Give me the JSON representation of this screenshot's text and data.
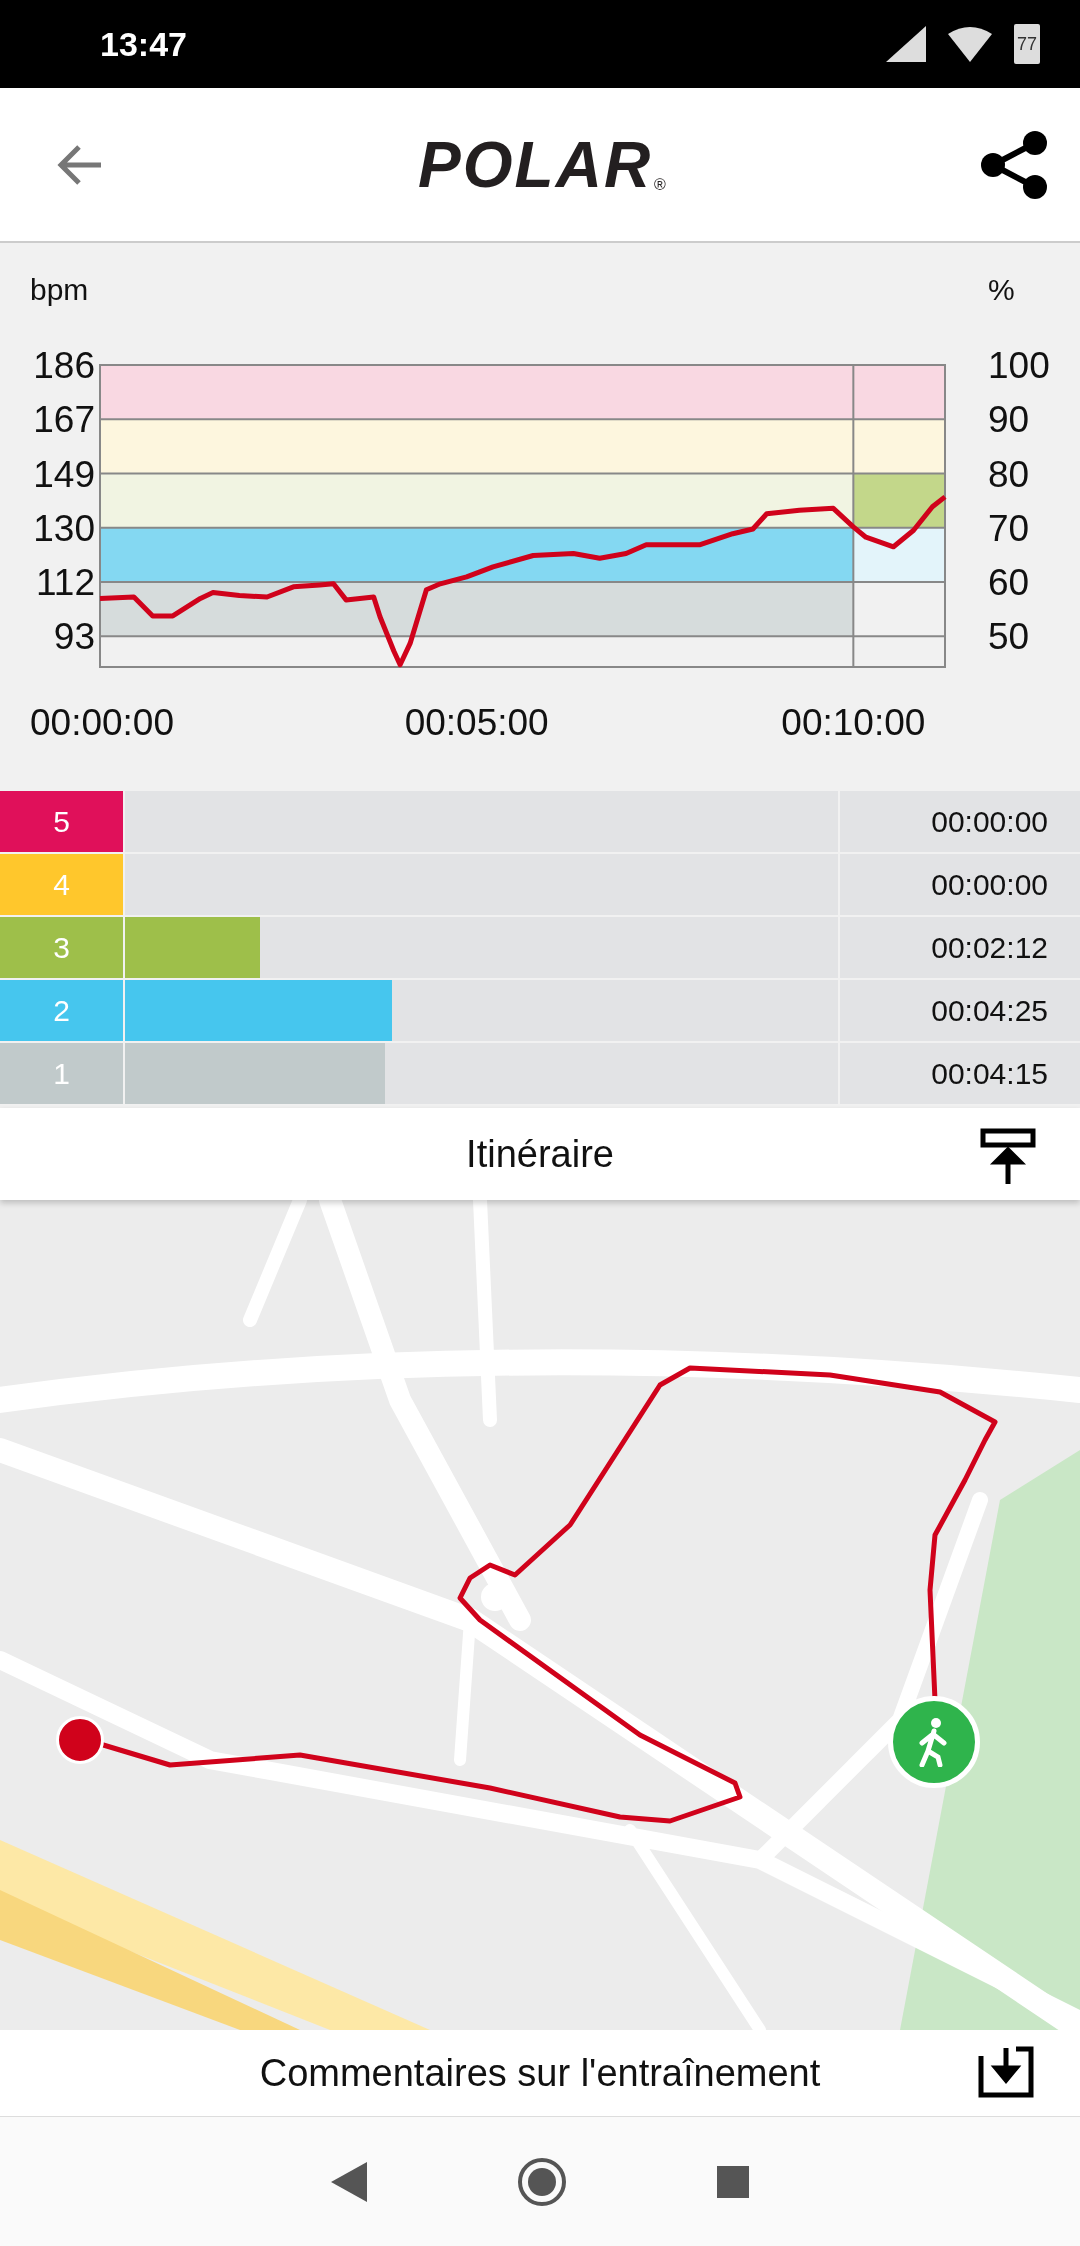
{
  "status_bar": {
    "time": "13:47",
    "battery": "77"
  },
  "header": {
    "logo": "POLAR",
    "logo_mark": "®"
  },
  "heart_rate": {
    "left_unit": "bpm",
    "right_unit": "%",
    "right_ticks": [
      "100",
      "90",
      "80",
      "70",
      "60",
      "50"
    ],
    "zone_colors": [
      {
        "color": "#f9d8e2"
      },
      {
        "color": "#fdf6de"
      },
      {
        "color": "#f1f4e2"
      },
      {
        "color": "#84d8f2"
      },
      {
        "color": "#d6dcdc"
      }
    ],
    "current_column": [
      {
        "color": "#f9d8e2"
      },
      {
        "color": "#fdf6de"
      },
      {
        "color": "#c3d78a"
      },
      {
        "color": "#e3f4fa"
      }
    ],
    "chart_data": {
      "type": "line",
      "grid": true,
      "x": [
        0,
        27,
        42,
        58,
        80,
        90,
        111,
        133,
        154,
        175,
        186,
        196,
        218,
        223,
        234,
        239,
        247,
        260,
        271,
        292,
        313,
        345,
        377,
        398,
        419,
        435,
        478,
        504,
        520,
        531,
        557,
        584,
        600,
        610,
        632,
        648,
        663,
        673
      ],
      "series": [
        {
          "color": "#d0021b",
          "values": [
            106,
            106.5,
            100,
            100,
            106,
            108,
            107,
            106.5,
            110,
            110.6,
            111,
            105.5,
            106.5,
            99.7,
            88,
            83.3,
            90.6,
            109,
            111,
            113.4,
            116.8,
            120.7,
            121.4,
            119.8,
            121.4,
            124.4,
            124.4,
            128.2,
            129.8,
            135,
            136.2,
            136.9,
            130.5,
            127,
            123.7,
            129.4,
            137.4,
            140.8
          ]
        }
      ],
      "xlim": [
        0,
        673
      ],
      "ylim": [
        82.5,
        186
      ],
      "xticks": [
        {
          "value": 0,
          "label": "00:00:00"
        },
        {
          "value": 300,
          "label": "00:05:00"
        },
        {
          "value": 600,
          "label": "00:10:00"
        }
      ],
      "yticks": [
        {
          "value": 93,
          "label": "93"
        },
        {
          "value": 111.6,
          "label": "112"
        },
        {
          "value": 130.2,
          "label": "130"
        },
        {
          "value": 148.8,
          "label": "149"
        },
        {
          "value": 167.4,
          "label": "167"
        },
        {
          "value": 186,
          "label": "186"
        }
      ]
    }
  },
  "zone_times": [
    {
      "zone": "5",
      "color": "#e0105a",
      "level": 0,
      "time": "00:00:00"
    },
    {
      "zone": "4",
      "color": "#ffc72c",
      "level": 0,
      "time": "00:00:00"
    },
    {
      "zone": "3",
      "color": "#9ebf4a",
      "level": 0.19,
      "time": "00:02:12"
    },
    {
      "zone": "2",
      "color": "#46c6ee",
      "level": 0.375,
      "time": "00:04:25"
    },
    {
      "zone": "1",
      "color": "#c1cacb",
      "level": 0.365,
      "time": "00:04:15"
    }
  ],
  "route": {
    "title": "Itinéraire"
  },
  "footer": {
    "title": "Commentaires sur l'entraînement"
  }
}
